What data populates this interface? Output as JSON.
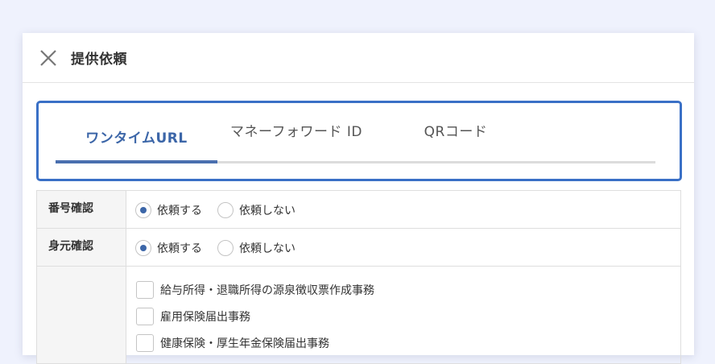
{
  "dialog": {
    "title": "提供依頼",
    "close_icon": "close-icon"
  },
  "tabs": [
    {
      "label": "ワンタイムURL",
      "active": true
    },
    {
      "label": "マネーフォワード ID",
      "active": false
    },
    {
      "label": "QRコード",
      "active": false
    }
  ],
  "settings": {
    "number_check": {
      "label": "番号確認",
      "options": [
        {
          "label": "依頼する",
          "selected": true
        },
        {
          "label": "依頼しない",
          "selected": false
        }
      ]
    },
    "identity_check": {
      "label": "身元確認",
      "options": [
        {
          "label": "依頼する",
          "selected": true
        },
        {
          "label": "依頼しない",
          "selected": false
        }
      ]
    },
    "purposes": {
      "label": "",
      "items": [
        {
          "label": "給与所得・退職所得の源泉徴収票作成事務",
          "checked": false
        },
        {
          "label": "雇用保険届出事務",
          "checked": false
        },
        {
          "label": "健康保険・厚生年金保険届出事務",
          "checked": false
        }
      ]
    }
  },
  "colors": {
    "accent": "#3c66a8",
    "focus_border": "#3a70c6",
    "background": "#eff2fd"
  }
}
